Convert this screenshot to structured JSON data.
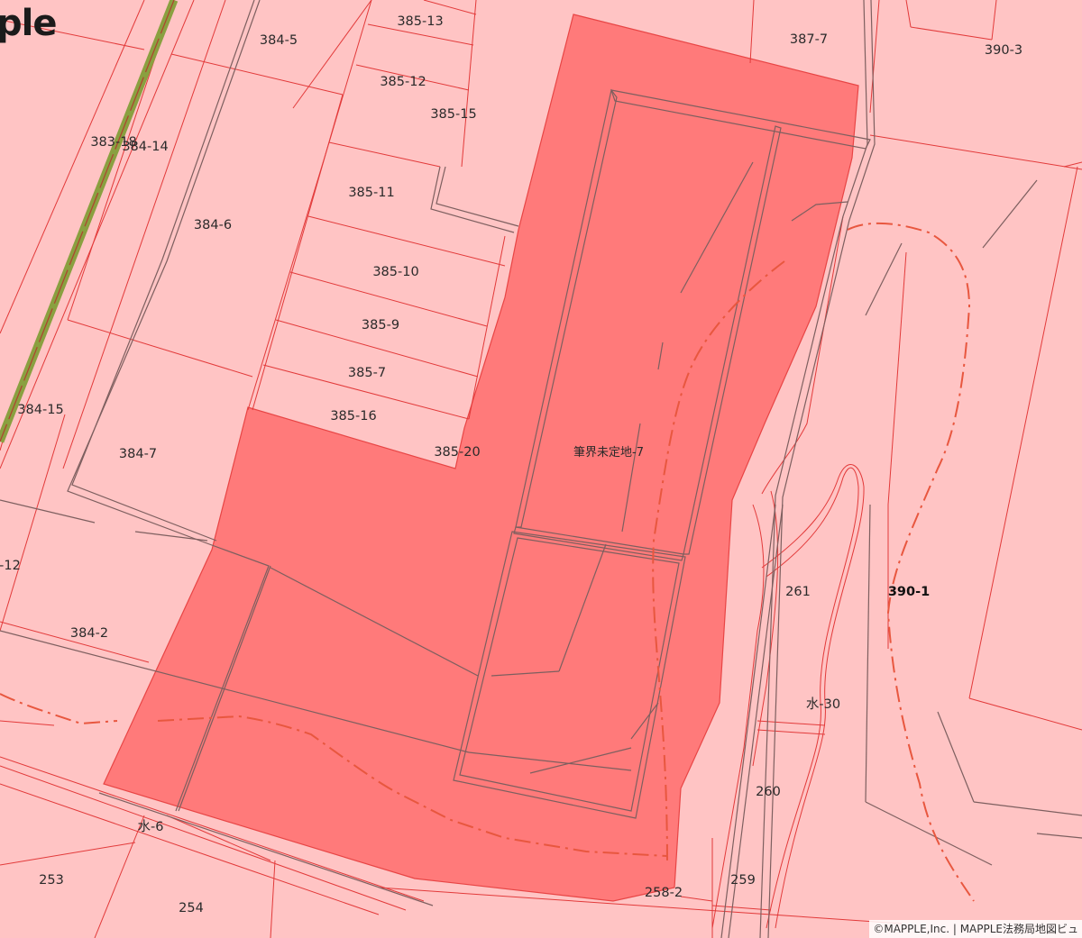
{
  "map": {
    "logo_text": "ple",
    "attribution": "©MAPPLE,Inc. | MAPPLE法務局地図ビュ",
    "colors": {
      "base_fill": "#ffc4c4",
      "highlight_fill": "#ff7a7a",
      "parcel_border": "#e23a3a",
      "building_outline": "#7d5f5f",
      "contour_line": "#e8573f",
      "rail_line": "#8aa040"
    },
    "highlighted_parcel": "筆界未定地-7",
    "parcels": [
      {
        "id": "p-384-5",
        "label": "384-5",
        "bold": false
      },
      {
        "id": "p-385-13",
        "label": "385-13",
        "bold": false
      },
      {
        "id": "p-387-7",
        "label": "387-7",
        "bold": false
      },
      {
        "id": "p-390-3",
        "label": "390-3",
        "bold": false
      },
      {
        "id": "p-385-12",
        "label": "385-12",
        "bold": false
      },
      {
        "id": "p-385-15",
        "label": "385-15",
        "bold": false
      },
      {
        "id": "p-383-18",
        "label": "383-18",
        "bold": false
      },
      {
        "id": "p-384-14",
        "label": "384-14",
        "bold": false
      },
      {
        "id": "p-385-11",
        "label": "385-11",
        "bold": false
      },
      {
        "id": "p-384-6",
        "label": "384-6",
        "bold": false
      },
      {
        "id": "p-385-10",
        "label": "385-10",
        "bold": false
      },
      {
        "id": "p-385-9",
        "label": "385-9",
        "bold": false
      },
      {
        "id": "p-385-7",
        "label": "385-7",
        "bold": false
      },
      {
        "id": "p-384-15",
        "label": "384-15",
        "bold": false
      },
      {
        "id": "p-385-16",
        "label": "385-16",
        "bold": false
      },
      {
        "id": "p-385-20",
        "label": "385-20",
        "bold": false
      },
      {
        "id": "p-384-7",
        "label": "384-7",
        "bold": false
      },
      {
        "id": "p-undetermined-7",
        "label": "筆界未定地-7",
        "bold": false
      },
      {
        "id": "p-12",
        "label": "-12",
        "bold": false
      },
      {
        "id": "p-261",
        "label": "261",
        "bold": false
      },
      {
        "id": "p-390-1",
        "label": "390-1",
        "bold": true
      },
      {
        "id": "p-384-2",
        "label": "384-2",
        "bold": false
      },
      {
        "id": "p-mizu-30",
        "label": "水-30",
        "bold": false
      },
      {
        "id": "p-260",
        "label": "260",
        "bold": false
      },
      {
        "id": "p-mizu-6",
        "label": "水-6",
        "bold": false
      },
      {
        "id": "p-253",
        "label": "253",
        "bold": false
      },
      {
        "id": "p-259",
        "label": "259",
        "bold": false
      },
      {
        "id": "p-254",
        "label": "254",
        "bold": false
      },
      {
        "id": "p-258-2",
        "label": "258-2",
        "bold": false
      }
    ]
  }
}
